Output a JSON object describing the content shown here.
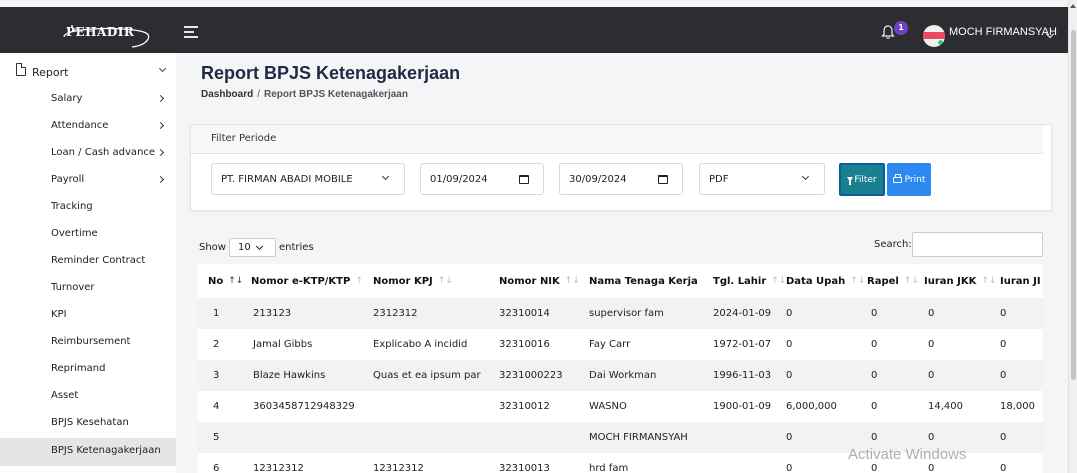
{
  "header": {
    "logo_text": "PEHADIR",
    "notification_count": "1",
    "username": "MOCH FIRMANSYAH",
    "colors": {
      "topbar": "#2c2d30",
      "badge": "#6f42c1"
    }
  },
  "sidebar": {
    "section_label": "Report",
    "items": [
      {
        "label": "Salary",
        "has_submenu": true
      },
      {
        "label": "Attendance",
        "has_submenu": true
      },
      {
        "label": "Loan / Cash advance",
        "has_submenu": true
      },
      {
        "label": "Payroll",
        "has_submenu": true
      },
      {
        "label": "Tracking",
        "has_submenu": false
      },
      {
        "label": "Overtime",
        "has_submenu": false
      },
      {
        "label": "Reminder Contract",
        "has_submenu": false
      },
      {
        "label": "Turnover",
        "has_submenu": false
      },
      {
        "label": "KPI",
        "has_submenu": false
      },
      {
        "label": "Reimbursement",
        "has_submenu": false
      },
      {
        "label": "Reprimand",
        "has_submenu": false
      },
      {
        "label": "Asset",
        "has_submenu": false
      },
      {
        "label": "BPJS Kesehatan",
        "has_submenu": false
      },
      {
        "label": "BPJS Ketenagakerjaan",
        "has_submenu": false,
        "active": true
      }
    ]
  },
  "page": {
    "title": "Report BPJS Ketenagakerjaan",
    "breadcrumb": {
      "home": "Dashboard",
      "separator": "/",
      "current": "Report BPJS Ketenagakerjaan"
    }
  },
  "filter": {
    "title": "Filter Periode",
    "company": "PT. FIRMAN ABADI MOBILE",
    "start_date": "01/09/2024",
    "end_date": "30/09/2024",
    "format": "PDF",
    "filter_label": "Filter",
    "print_label": "Print",
    "colors": {
      "filter_button": "#1a7f8e",
      "print_button": "#2b89f0"
    }
  },
  "table_controls": {
    "show_label": "Show",
    "entries_value": "10",
    "entries_label": "entries",
    "search_label": "Search:",
    "search_value": ""
  },
  "table": {
    "columns": [
      {
        "label": "No",
        "sort": "asc"
      },
      {
        "label": "Nomor e-KTP/KTP",
        "sort": "none"
      },
      {
        "label": "Nomor KPJ",
        "sort": "none"
      },
      {
        "label": "Nomor NIK",
        "sort": "none"
      },
      {
        "label": "Nama Tenaga Kerja",
        "sort": "none"
      },
      {
        "label": "Tgl. Lahir",
        "sort": "none"
      },
      {
        "label": "Data Upah",
        "sort": "none"
      },
      {
        "label": "Rapel",
        "sort": "none"
      },
      {
        "label": "Iuran JKK",
        "sort": "none"
      },
      {
        "label": "Iuran JI",
        "sort": "none"
      }
    ],
    "rows": [
      [
        "1",
        "213123",
        "2312312",
        "32310014",
        "supervisor fam",
        "2024-01-09",
        "0",
        "0",
        "0",
        "0"
      ],
      [
        "2",
        "Jamal Gibbs",
        "Explicabo A incidid",
        "32310016",
        "Fay Carr",
        "1972-01-07",
        "0",
        "0",
        "0",
        "0"
      ],
      [
        "3",
        "Blaze Hawkins",
        "Quas et ea ipsum par",
        "3231000223",
        "Dai Workman",
        "1996-11-03",
        "0",
        "0",
        "0",
        "0"
      ],
      [
        "4",
        "3603458712948329",
        "",
        "32310012",
        "WASNO",
        "1900-01-09",
        "6,000,000",
        "0",
        "14,400",
        "18,000"
      ],
      [
        "5",
        "",
        "",
        "",
        "MOCH FIRMANSYAH",
        "",
        "0",
        "0",
        "0",
        "0"
      ],
      [
        "6",
        "12312312",
        "12312312",
        "32310013",
        "hrd fam",
        "",
        "0",
        "0",
        "0",
        "0"
      ]
    ]
  },
  "watermark": "Activate Windows"
}
